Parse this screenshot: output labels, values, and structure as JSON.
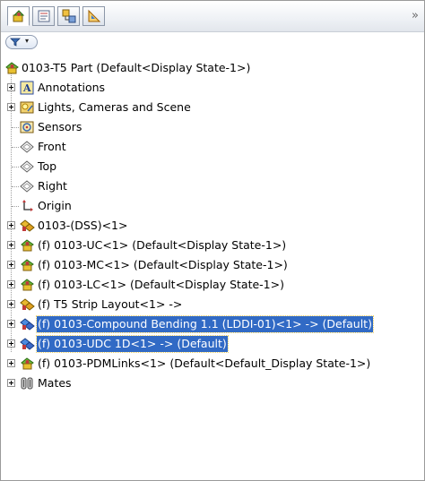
{
  "colors": {
    "selection": "#316ac5",
    "part_green": "#4a9a2a",
    "assembly_yellow": "#d8a81a"
  },
  "toolbar": {
    "tabs": [
      {
        "icon": "feature-manager-icon"
      },
      {
        "icon": "property-manager-icon"
      },
      {
        "icon": "configuration-manager-icon"
      },
      {
        "icon": "dimxpert-manager-icon"
      }
    ],
    "more": "»"
  },
  "filter": {
    "icon": "filter-icon",
    "dropdown": "▾"
  },
  "tree": {
    "root": "0103-T5 Part  (Default<Display State-1>)",
    "items": [
      {
        "label": "Annotations",
        "icon": "annotations-icon"
      },
      {
        "label": "Lights, Cameras and Scene",
        "icon": "lights-icon"
      },
      {
        "label": "Sensors",
        "icon": "sensors-icon"
      },
      {
        "label": "Front",
        "icon": "plane-icon"
      },
      {
        "label": "Top",
        "icon": "plane-icon"
      },
      {
        "label": "Right",
        "icon": "plane-icon"
      },
      {
        "label": "Origin",
        "icon": "origin-icon"
      },
      {
        "label": "0103-(DSS)<1>",
        "icon": "assembly-icon"
      },
      {
        "label": "(f) 0103-UC<1> (Default<Display State-1>)",
        "icon": "part-icon"
      },
      {
        "label": "(f) 0103-MC<1> (Default<Display State-1>)",
        "icon": "part-icon"
      },
      {
        "label": "(f) 0103-LC<1> (Default<Display State-1>)",
        "icon": "part-icon"
      },
      {
        "label": "(f) T5 Strip Layout<1> ->",
        "icon": "assembly-icon"
      },
      {
        "label": "(f) 0103-Compound Bending 1.1 (LDDI-01)<1> -> (Default)",
        "icon": "assembly-blue-icon"
      },
      {
        "label": "(f) 0103-UDC 1D<1> -> (Default)",
        "icon": "assembly-blue-icon"
      },
      {
        "label": "(f) 0103-PDMLinks<1> (Default<Default_Display State-1>)",
        "icon": "part-icon"
      },
      {
        "label": "Mates",
        "icon": "mates-icon"
      }
    ]
  }
}
